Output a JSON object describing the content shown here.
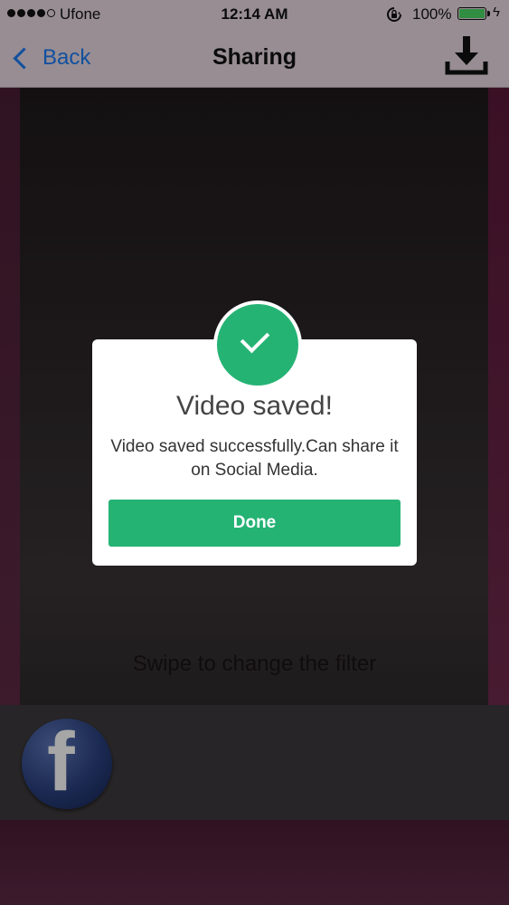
{
  "status_bar": {
    "carrier": "Ufone",
    "time": "12:14 AM",
    "battery_percent": "100%",
    "signal_bars": 4,
    "signal_max": 5,
    "battery_color": "#4cd964",
    "icons": [
      "signal-icon",
      "rotation-lock-icon",
      "battery-icon",
      "charging-bolt-icon"
    ]
  },
  "nav": {
    "back_label": "Back",
    "title": "Sharing",
    "back_color": "#1c7cf4",
    "right_icon": "download-icon"
  },
  "main": {
    "swipe_hint": "Swipe to change the filter",
    "share_targets": [
      {
        "name": "facebook",
        "glyph": "f",
        "icon": "facebook-icon"
      }
    ]
  },
  "dialog": {
    "title": "Video saved!",
    "message": "Video saved successfully.Can share it on Social Media.",
    "button_label": "Done",
    "accent_color": "#25b374",
    "icon": "checkmark-icon"
  }
}
